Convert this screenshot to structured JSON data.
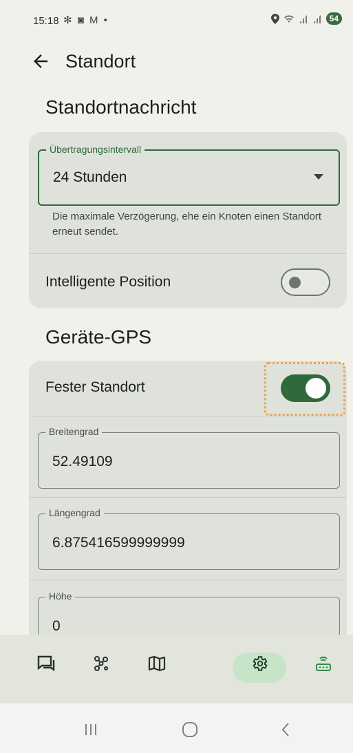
{
  "status": {
    "time": "15:18",
    "left_icons": "✻ ◙ M •",
    "battery": "54"
  },
  "appbar": {
    "title": "Standort"
  },
  "sections": {
    "position_message": "Standortnachricht",
    "device_gps": "Geräte-GPS"
  },
  "interval": {
    "label": "Übertragungsintervall",
    "value": "24 Stunden",
    "helper": "Die maximale Verzögerung, ehe ein Knoten einen Standort erneut sendet."
  },
  "smart_position": {
    "label": "Intelligente Position",
    "enabled": false
  },
  "fixed_position": {
    "label": "Fester Standort",
    "enabled": true
  },
  "latitude": {
    "label": "Breitengrad",
    "value": "52.49109"
  },
  "longitude": {
    "label": "Längengrad",
    "value": "6.875416599999999"
  },
  "altitude": {
    "label": "Höhe",
    "value": "0"
  },
  "bottom_nav": {
    "items": [
      "messages-icon",
      "nodes-icon",
      "map-icon",
      "settings-icon",
      "radio-config-icon"
    ],
    "selected": "settings-icon"
  },
  "colors": {
    "accent": "#2e6a3b",
    "card": "#dfe2da",
    "background": "#f0f1ea",
    "highlight": "#e8a54a"
  }
}
